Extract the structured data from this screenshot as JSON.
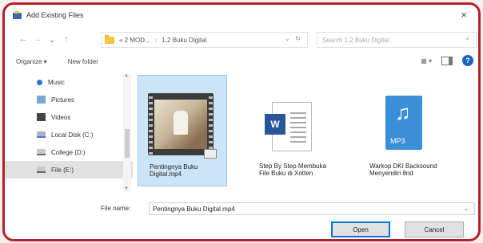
{
  "window": {
    "title": "Add Existing Files",
    "close_glyph": "×"
  },
  "address_bar": {
    "back": "←",
    "forward": "→",
    "recent": "⌄",
    "up": "↑",
    "crumbs": [
      "« 2 MOD...",
      "1.2 Buku Digital"
    ],
    "separator": "›",
    "dropdown": "⌄",
    "refresh": "↻",
    "search_placeholder": "Search 1.2 Buku Digital",
    "search_icon": "⌕"
  },
  "toolbar": {
    "organize": "Organize ▾",
    "new_folder": "New folder",
    "view_icon": "▦ ▾",
    "help": "?"
  },
  "nav_pane": {
    "items": [
      {
        "label": "Music",
        "icon": "music-icon"
      },
      {
        "label": "Pictures",
        "icon": "pictures-icon"
      },
      {
        "label": "Videos",
        "icon": "videos-icon"
      },
      {
        "label": "Local Disk (C:)",
        "icon": "disk-icon"
      },
      {
        "label": "College (D:)",
        "icon": "drive-icon"
      },
      {
        "label": "File (E:)",
        "icon": "drive-icon",
        "selected": true
      }
    ]
  },
  "files": [
    {
      "name": "Pentingnya Buku Digital.mp4",
      "type": "video",
      "selected": true
    },
    {
      "name": "Step By Step Membuka File Buku di Xotten",
      "type": "word",
      "badge": "W"
    },
    {
      "name": "Warkop DKI Backsound Menyendiri 8nd",
      "type": "audio",
      "badge": "MP3",
      "note": "♫"
    }
  ],
  "footer": {
    "file_name_label": "File name:",
    "file_name_value": "Pentingnya Buku Digital.mp4",
    "open": "Open",
    "cancel": "Cancel"
  }
}
